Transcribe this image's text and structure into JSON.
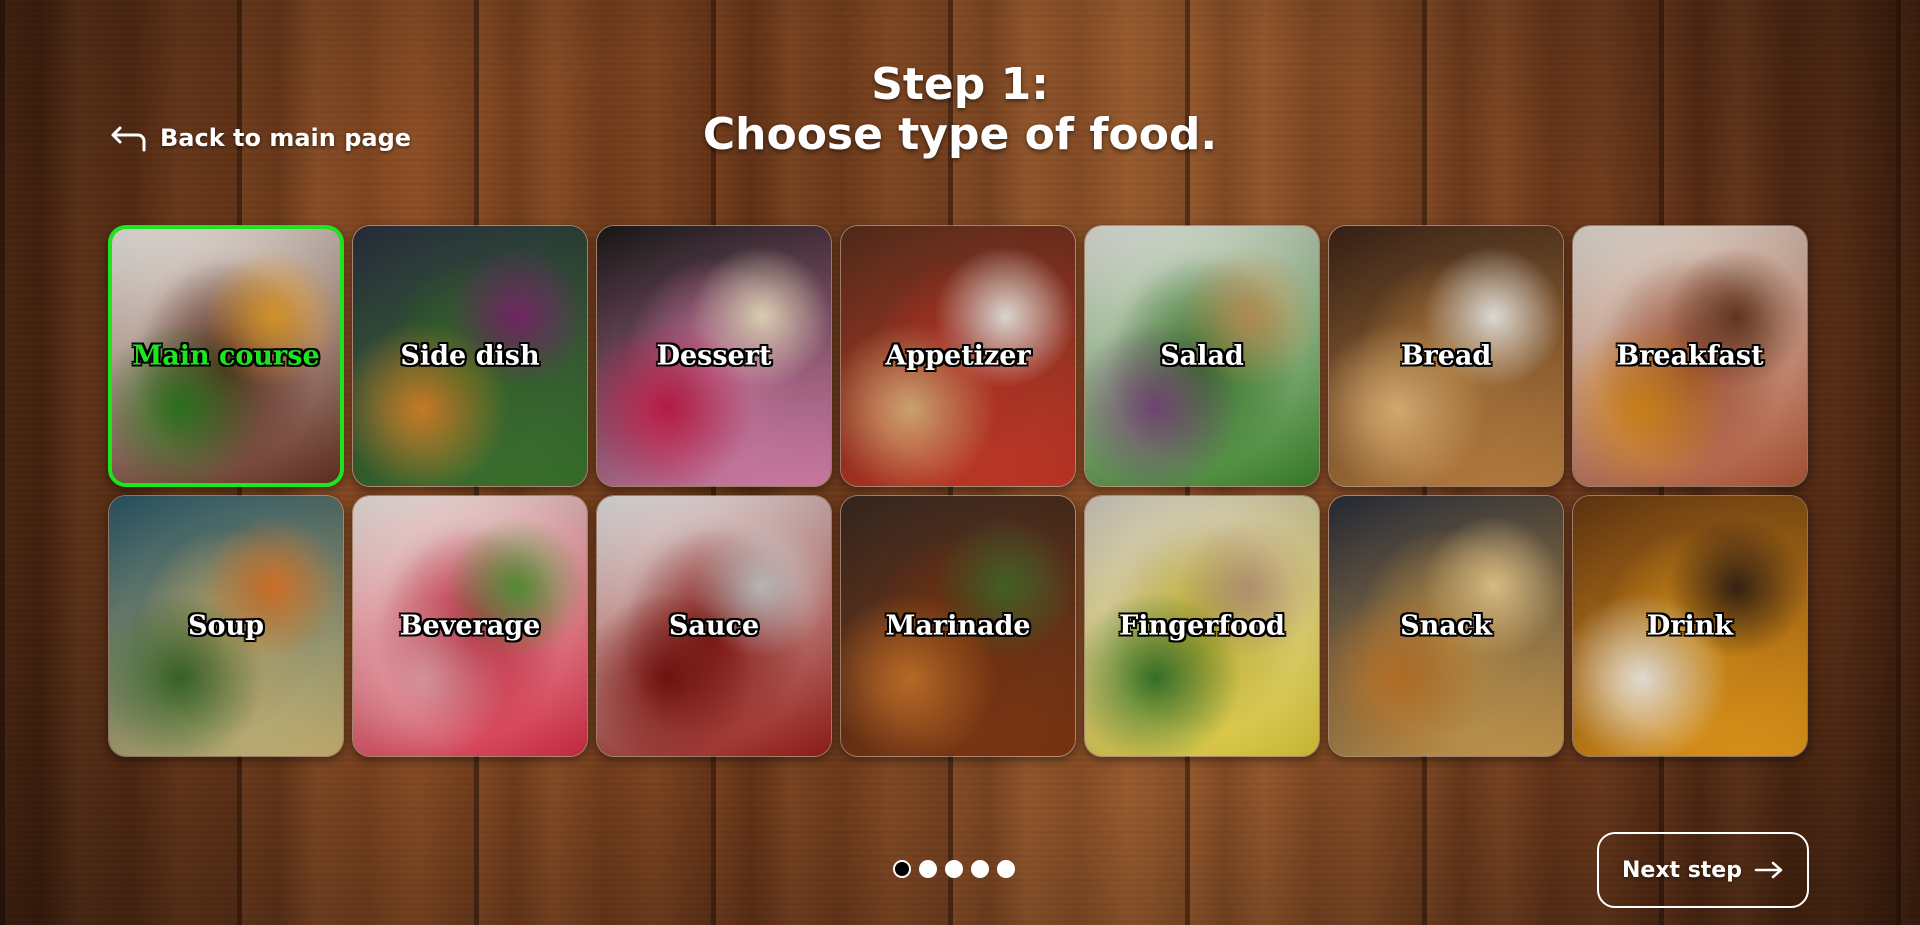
{
  "header": {
    "back_label": "Back to main page",
    "title_line1": "Step 1:",
    "title_line2": "Choose type of food."
  },
  "food_types": [
    {
      "label": "Main course",
      "selected": true,
      "icon": "main-course-image",
      "colors": [
        "#f2efe9",
        "#6b3324",
        "#2f7a1f",
        "#e7a12c"
      ]
    },
    {
      "label": "Side dish",
      "selected": false,
      "icon": "side-dish-image",
      "colors": [
        "#2b3140",
        "#3e7d2d",
        "#d9862a",
        "#7d2a6e"
      ]
    },
    {
      "label": "Dessert",
      "selected": false,
      "icon": "dessert-image",
      "colors": [
        "#1a1a1a",
        "#e98ab8",
        "#c81d4a",
        "#f1e3c6"
      ]
    },
    {
      "label": "Appetizer",
      "selected": false,
      "icon": "appetizer-image",
      "colors": [
        "#5a2f1c",
        "#d33a2a",
        "#e0b27a",
        "#f2eee8"
      ]
    },
    {
      "label": "Salad",
      "selected": false,
      "icon": "salad-image",
      "colors": [
        "#e8e8e4",
        "#3e8a2d",
        "#7a4a7a",
        "#c49a5a"
      ]
    },
    {
      "label": "Bread",
      "selected": false,
      "icon": "bread-image",
      "colors": [
        "#3b2417",
        "#c98a45",
        "#e6b97a",
        "#f4f1ea"
      ]
    },
    {
      "label": "Breakfast",
      "selected": false,
      "icon": "breakfast-image",
      "colors": [
        "#e6e2da",
        "#b85a3a",
        "#d98a1a",
        "#6a3a22"
      ]
    },
    {
      "label": "Soup",
      "selected": false,
      "icon": "soup-image",
      "colors": [
        "#2c5a6a",
        "#d8c07a",
        "#3a6a2a",
        "#e07a2a"
      ]
    },
    {
      "label": "Beverage",
      "selected": false,
      "icon": "beverage-image",
      "colors": [
        "#f1ece6",
        "#e0304a",
        "#e8a0a8",
        "#5a9a3a"
      ]
    },
    {
      "label": "Sauce",
      "selected": false,
      "icon": "sauce-image",
      "colors": [
        "#eaeaea",
        "#a0201a",
        "#7a1410",
        "#c9c9c9"
      ]
    },
    {
      "label": "Marinade",
      "selected": false,
      "icon": "marinade-image",
      "colors": [
        "#3a2a22",
        "#8a3a12",
        "#c9742a",
        "#4a6a2a"
      ]
    },
    {
      "label": "Fingerfood",
      "selected": false,
      "icon": "fingerfood-image",
      "colors": [
        "#d8d2c8",
        "#e6d23a",
        "#3a7a2a",
        "#c2a07a"
      ]
    },
    {
      "label": "Snack",
      "selected": false,
      "icon": "snack-image",
      "colors": [
        "#2a2e3a",
        "#d7a552",
        "#c0772a",
        "#f0d090"
      ]
    },
    {
      "label": "Drink",
      "selected": false,
      "icon": "drink-image",
      "colors": [
        "#6a3a12",
        "#f2a21a",
        "#f6f1e6",
        "#3a2414"
      ]
    }
  ],
  "pagination": {
    "total": 5,
    "current": 1
  },
  "footer": {
    "next_label": "Next step"
  },
  "theme": {
    "accent": "#1ee61e",
    "text": "#ffffff"
  }
}
